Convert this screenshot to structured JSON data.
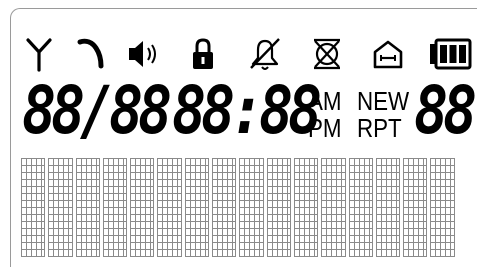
{
  "icons": [
    {
      "name": "antenna-icon"
    },
    {
      "name": "phone-handset-icon"
    },
    {
      "name": "speaker-volume-icon"
    },
    {
      "name": "lock-icon"
    },
    {
      "name": "bell-muted-icon"
    },
    {
      "name": "ringer-off-icon"
    },
    {
      "name": "home-base-icon"
    },
    {
      "name": "battery-icon"
    }
  ],
  "display": {
    "date": "88/88",
    "time": "88:88",
    "counter": "88",
    "am": "AM",
    "pm": "PM",
    "new": "NEW",
    "rpt": "RPT"
  },
  "dot_matrix": {
    "rows": 2,
    "cells_per_row": 16
  }
}
